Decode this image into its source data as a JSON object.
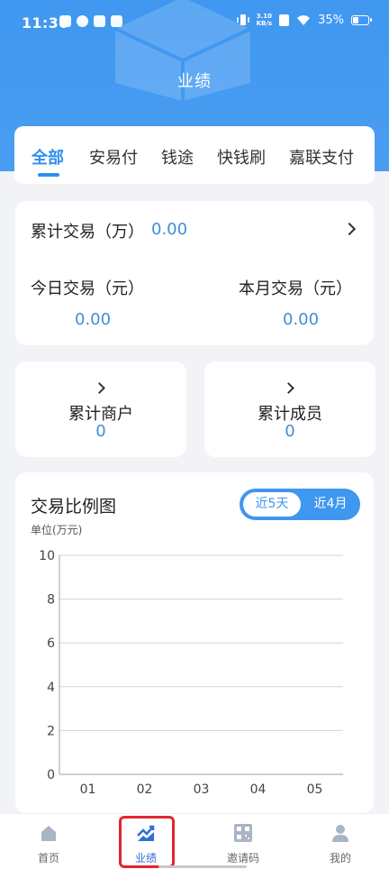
{
  "status": {
    "time": "11:36",
    "net_speed_top": "3.10",
    "net_speed_bottom": "KB/s",
    "battery": "35%"
  },
  "header": {
    "title": "业绩"
  },
  "tabs": [
    {
      "label": "全部",
      "active": true
    },
    {
      "label": "安易付",
      "active": false
    },
    {
      "label": "钱途",
      "active": false
    },
    {
      "label": "快钱刷",
      "active": false
    },
    {
      "label": "嘉联支付",
      "active": false
    }
  ],
  "summary": {
    "total_label": "累计交易（万）",
    "total_value": "0.00",
    "today_label": "今日交易（元）",
    "today_value": "0.00",
    "month_label": "本月交易（元）",
    "month_value": "0.00"
  },
  "merchants": {
    "label": "累计商户",
    "value": "0"
  },
  "members": {
    "label": "累计成员",
    "value": "0"
  },
  "chart_section": {
    "title": "交易比例图",
    "unit": "单位(万元)",
    "range_selected": "近5天",
    "range_other": "近4月"
  },
  "chart_data": {
    "type": "line",
    "categories": [
      "01",
      "02",
      "03",
      "04",
      "05"
    ],
    "series": [
      {
        "values": [
          0,
          0,
          0,
          0,
          0
        ]
      }
    ],
    "ylim": [
      0,
      10
    ],
    "yticks": [
      "0",
      "2",
      "4",
      "6",
      "8",
      "10"
    ],
    "grid": true,
    "title": "",
    "xlabel": "",
    "ylabel": ""
  },
  "tabbar": [
    {
      "label": "首页",
      "icon": "home-icon"
    },
    {
      "label": "业绩",
      "icon": "chart-icon",
      "active": true
    },
    {
      "label": "邀请码",
      "icon": "qr-code-icon"
    },
    {
      "label": "我的",
      "icon": "user-icon"
    }
  ],
  "colors": {
    "primary": "#3f97f0",
    "accent_value": "#3e8ed8",
    "highlight": "#e4242c"
  }
}
